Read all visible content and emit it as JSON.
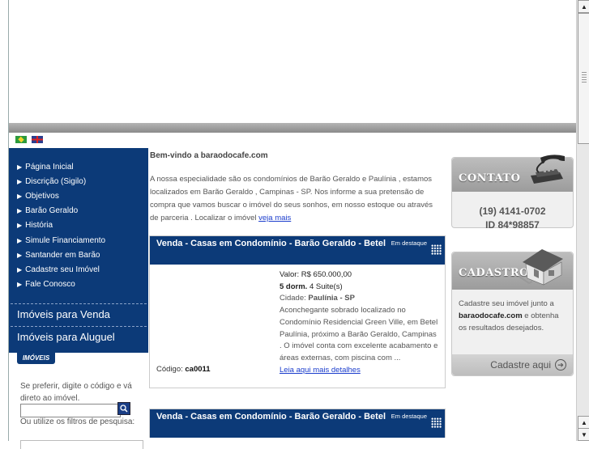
{
  "flags": {
    "br_label": "Português",
    "uk_label": "English"
  },
  "sidebar": {
    "menu": [
      "Página Inicial",
      "Discrição (Sigilo)",
      "Objetivos",
      "Barão Geraldo",
      "História",
      "Simule Financiamento",
      "Santander em Barão",
      "Cadastre seu Imóvel",
      "Fale Conosco"
    ],
    "venda_link": "Imóveis para Venda",
    "aluguel_link": "Imóveis para Aluguel",
    "imoveis_tab": "IMÓVEIS",
    "code_prompt": "Se preferir, digite o código e vá direto ao imóvel.",
    "code_input_value": "",
    "filter_text": "Ou utilize os filtros de pesquisa:"
  },
  "main": {
    "welcome": "Bem-vindo a baraodocafe.com",
    "intro": "A nossa especialidade são os condomínios de Barão Geraldo e Paulínia , estamos localizados em Barão Geraldo , Campinas - SP. Nos informe a sua pretensão de compra que vamos buscar o imóvel do seus sonhos, em nosso estoque ou através de parceria . Localizar o imóvel ",
    "intro_link": "veja mais"
  },
  "listings": [
    {
      "title": "Venda - Casas em Condomínio - Barão Geraldo - Betel",
      "destaque": "Em destaque",
      "valor": "Valor: R$ 650.000,00",
      "dorm": "5 dorm.",
      "suites": " 4 Suite(s)",
      "cidade_label": "Cidade: ",
      "cidade": "Paulínia - SP",
      "descricao": "Aconchegante sobrado localizado no Condomínio Residencial Green Ville, em Betel Paulínia, próximo a Barão Geraldo, Campinas . O imóvel conta com excelente acabamento e áreas externas, com piscina com ...",
      "link": "Leia aqui mais detalhes",
      "codigo_label": "Código: ",
      "codigo": "ca0011"
    },
    {
      "title": "Venda - Casas em Condomínio - Barão Geraldo - Betel",
      "destaque": "Em destaque"
    }
  ],
  "contato": {
    "title": "CONTATO",
    "phone": "(19) 4141-0702",
    "id": "ID 84*98857",
    "icon": "telephone-icon"
  },
  "cadastro": {
    "title": "CADASTRO",
    "text_before": "Cadastre seu imóvel junto a ",
    "site": "baraodocafe.com",
    "text_after": " e obtenha os resultados desejados.",
    "button": "Cadastre aqui",
    "icon": "house-icon"
  }
}
